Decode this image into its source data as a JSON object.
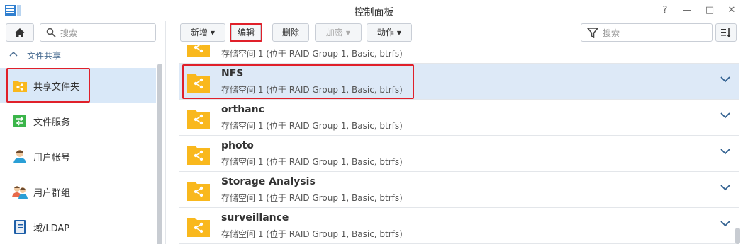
{
  "window": {
    "title": "控制面板",
    "controls": [
      "?",
      "—",
      "□",
      "✕"
    ]
  },
  "sidebar": {
    "search_placeholder": "搜索",
    "section": "文件共享",
    "items": [
      {
        "label": "共享文件夹",
        "icon": "shared-folder-icon",
        "selected": true
      },
      {
        "label": "文件服务",
        "icon": "file-services-icon",
        "selected": false
      },
      {
        "label": "用户帐号",
        "icon": "user-icon",
        "selected": false
      },
      {
        "label": "用户群组",
        "icon": "group-icon",
        "selected": false
      },
      {
        "label": "域/LDAP",
        "icon": "domain-ldap-icon",
        "selected": false
      }
    ]
  },
  "toolbar": {
    "create": "新增",
    "edit": "编辑",
    "delete": "删除",
    "encrypt": "加密",
    "action": "动作",
    "search_placeholder": "搜索"
  },
  "colors": {
    "accent": "#f9b81d",
    "selection": "#dde9f7",
    "highlight_box": "#e0202a"
  },
  "folders": [
    {
      "name": "",
      "location": "存储空间 1 (位于 RAID Group 1, Basic, btrfs)"
    },
    {
      "name": "NFS",
      "location": "存储空间 1 (位于 RAID Group 1, Basic, btrfs)",
      "selected": true
    },
    {
      "name": "orthanc",
      "location": "存储空间 1 (位于 RAID Group 1, Basic, btrfs)"
    },
    {
      "name": "photo",
      "location": "存储空间 1 (位于 RAID Group 1, Basic, btrfs)"
    },
    {
      "name": "Storage Analysis",
      "location": "存储空间 1 (位于 RAID Group 1, Basic, btrfs)"
    },
    {
      "name": "surveillance",
      "location": "存储空间 1 (位于 RAID Group 1, Basic, btrfs)"
    }
  ]
}
